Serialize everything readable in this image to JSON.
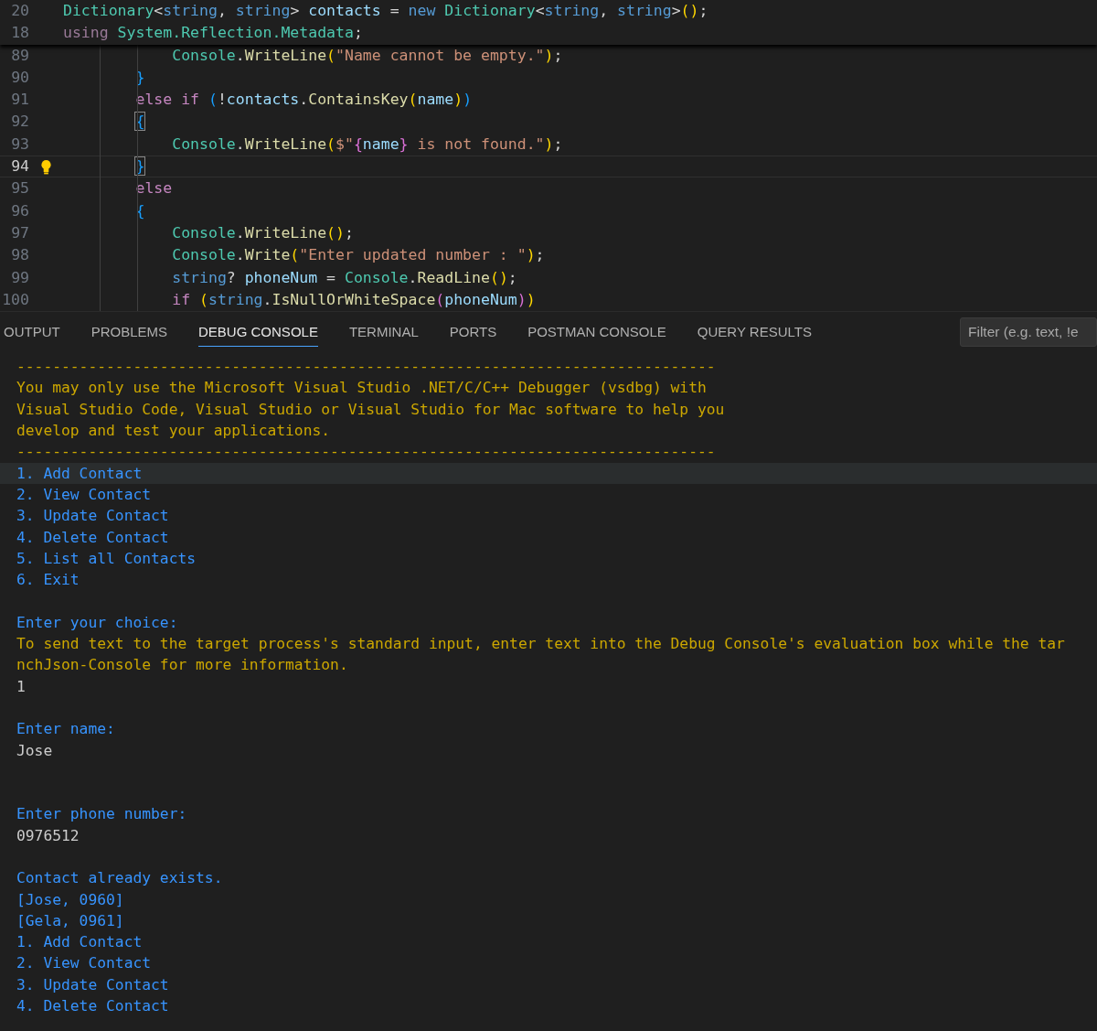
{
  "editor": {
    "sticky_lines": [
      {
        "number": "20",
        "tokens": [
          {
            "text": "Dictionary",
            "kind": "type"
          },
          {
            "text": "<",
            "kind": "plain"
          },
          {
            "text": "string",
            "kind": "key"
          },
          {
            "text": ", ",
            "kind": "plain"
          },
          {
            "text": "string",
            "kind": "key"
          },
          {
            "text": "> ",
            "kind": "plain"
          },
          {
            "text": "contacts",
            "kind": "var"
          },
          {
            "text": " = ",
            "kind": "plain"
          },
          {
            "text": "new ",
            "kind": "key"
          },
          {
            "text": "Dictionary",
            "kind": "type"
          },
          {
            "text": "<",
            "kind": "plain"
          },
          {
            "text": "string",
            "kind": "key"
          },
          {
            "text": ", ",
            "kind": "plain"
          },
          {
            "text": "string",
            "kind": "key"
          },
          {
            "text": ">",
            "kind": "plain"
          },
          {
            "text": "()",
            "kind": "b1"
          },
          {
            "text": ";",
            "kind": "plain"
          }
        ]
      },
      {
        "number": "18",
        "tokens": [
          {
            "text": "using ",
            "kind": "ctrl"
          },
          {
            "text": "System.Reflection.Metadata",
            "kind": "type"
          },
          {
            "text": ";",
            "kind": "plain"
          }
        ]
      }
    ],
    "lines": [
      {
        "number": "89",
        "current": false,
        "lightbulb": false,
        "tokens": [
          {
            "text": "            Console",
            "kind": "type"
          },
          {
            "text": ".",
            "kind": "plain"
          },
          {
            "text": "WriteLine",
            "kind": "fn"
          },
          {
            "text": "(",
            "kind": "b1"
          },
          {
            "text": "\"Name cannot be empty.\"",
            "kind": "str"
          },
          {
            "text": ")",
            "kind": "b1"
          },
          {
            "text": ";",
            "kind": "plain"
          }
        ]
      },
      {
        "number": "90",
        "current": false,
        "lightbulb": false,
        "tokens": [
          {
            "text": "        }",
            "kind": "b3"
          }
        ]
      },
      {
        "number": "91",
        "current": false,
        "lightbulb": false,
        "tokens": [
          {
            "text": "        else if ",
            "kind": "ctrl"
          },
          {
            "text": "(",
            "kind": "b3"
          },
          {
            "text": "!",
            "kind": "plain"
          },
          {
            "text": "contacts",
            "kind": "var"
          },
          {
            "text": ".",
            "kind": "plain"
          },
          {
            "text": "ContainsKey",
            "kind": "fn"
          },
          {
            "text": "(",
            "kind": "b1"
          },
          {
            "text": "name",
            "kind": "var"
          },
          {
            "text": ")",
            "kind": "b1"
          },
          {
            "text": ")",
            "kind": "b3"
          }
        ]
      },
      {
        "number": "92",
        "current": false,
        "lightbulb": false,
        "tokens": [
          {
            "text": "        {",
            "kind": "match"
          }
        ]
      },
      {
        "number": "93",
        "current": false,
        "lightbulb": false,
        "tokens": [
          {
            "text": "            Console",
            "kind": "type"
          },
          {
            "text": ".",
            "kind": "plain"
          },
          {
            "text": "WriteLine",
            "kind": "fn"
          },
          {
            "text": "(",
            "kind": "b1"
          },
          {
            "text": "$\"",
            "kind": "str"
          },
          {
            "text": "{",
            "kind": "b2"
          },
          {
            "text": "name",
            "kind": "var"
          },
          {
            "text": "}",
            "kind": "b2"
          },
          {
            "text": " is not found.\"",
            "kind": "str"
          },
          {
            "text": ")",
            "kind": "b1"
          },
          {
            "text": ";",
            "kind": "plain"
          }
        ]
      },
      {
        "number": "94",
        "current": true,
        "lightbulb": true,
        "tokens": [
          {
            "text": "        }",
            "kind": "match"
          }
        ]
      },
      {
        "number": "95",
        "current": false,
        "lightbulb": false,
        "tokens": [
          {
            "text": "        else",
            "kind": "ctrl"
          }
        ]
      },
      {
        "number": "96",
        "current": false,
        "lightbulb": false,
        "tokens": [
          {
            "text": "        {",
            "kind": "b3"
          }
        ]
      },
      {
        "number": "97",
        "current": false,
        "lightbulb": false,
        "tokens": [
          {
            "text": "            Console",
            "kind": "type"
          },
          {
            "text": ".",
            "kind": "plain"
          },
          {
            "text": "WriteLine",
            "kind": "fn"
          },
          {
            "text": "()",
            "kind": "b1"
          },
          {
            "text": ";",
            "kind": "plain"
          }
        ]
      },
      {
        "number": "98",
        "current": false,
        "lightbulb": false,
        "tokens": [
          {
            "text": "            Console",
            "kind": "type"
          },
          {
            "text": ".",
            "kind": "plain"
          },
          {
            "text": "Write",
            "kind": "fn"
          },
          {
            "text": "(",
            "kind": "b1"
          },
          {
            "text": "\"Enter updated number : \"",
            "kind": "str"
          },
          {
            "text": ")",
            "kind": "b1"
          },
          {
            "text": ";",
            "kind": "plain"
          }
        ]
      },
      {
        "number": "99",
        "current": false,
        "lightbulb": false,
        "tokens": [
          {
            "text": "            string",
            "kind": "key"
          },
          {
            "text": "? ",
            "kind": "plain"
          },
          {
            "text": "phoneNum",
            "kind": "var"
          },
          {
            "text": " = ",
            "kind": "plain"
          },
          {
            "text": "Console",
            "kind": "type"
          },
          {
            "text": ".",
            "kind": "plain"
          },
          {
            "text": "ReadLine",
            "kind": "fn"
          },
          {
            "text": "()",
            "kind": "b1"
          },
          {
            "text": ";",
            "kind": "plain"
          }
        ]
      },
      {
        "number": "100",
        "current": false,
        "lightbulb": false,
        "tokens": [
          {
            "text": "            if ",
            "kind": "ctrl"
          },
          {
            "text": "(",
            "kind": "b1"
          },
          {
            "text": "string",
            "kind": "key"
          },
          {
            "text": ".",
            "kind": "plain"
          },
          {
            "text": "IsNullOrWhiteSpace",
            "kind": "fn"
          },
          {
            "text": "(",
            "kind": "b2"
          },
          {
            "text": "phoneNum",
            "kind": "var"
          },
          {
            "text": ")",
            "kind": "b2"
          },
          {
            "text": ")",
            "kind": "b1"
          }
        ]
      }
    ]
  },
  "panel": {
    "tabs": [
      {
        "label": "OUTPUT",
        "selected": false
      },
      {
        "label": "PROBLEMS",
        "selected": false
      },
      {
        "label": "DEBUG CONSOLE",
        "selected": true
      },
      {
        "label": "TERMINAL",
        "selected": false
      },
      {
        "label": "PORTS",
        "selected": false
      },
      {
        "label": "POSTMAN CONSOLE",
        "selected": false
      },
      {
        "label": "QUERY RESULTS",
        "selected": false
      }
    ],
    "filter": {
      "placeholder": "Filter (e.g. text, !e"
    },
    "console": [
      {
        "kind": "warn",
        "text": "------------------------------------------------------------------------------",
        "selected": false
      },
      {
        "kind": "warn",
        "text": "You may only use the Microsoft Visual Studio .NET/C/C++ Debugger (vsdbg) with\nVisual Studio Code, Visual Studio or Visual Studio for Mac software to help you\ndevelop and test your applications.",
        "selected": false
      },
      {
        "kind": "warn",
        "text": "------------------------------------------------------------------------------",
        "selected": false
      },
      {
        "kind": "info",
        "text": "1. Add Contact",
        "selected": true
      },
      {
        "kind": "info",
        "text": "2. View Contact",
        "selected": false
      },
      {
        "kind": "info",
        "text": "3. Update Contact",
        "selected": false
      },
      {
        "kind": "info",
        "text": "4. Delete Contact",
        "selected": false
      },
      {
        "kind": "info",
        "text": "5. List all Contacts",
        "selected": false
      },
      {
        "kind": "info",
        "text": "6. Exit",
        "selected": false
      },
      {
        "kind": "blank",
        "selected": false
      },
      {
        "kind": "info",
        "text": "Enter your choice:",
        "selected": false
      },
      {
        "kind": "warn",
        "text": "To send text to the target process's standard input, enter text into the Debug Console's evaluation box while the tar\nnchJson-Console for more information.",
        "selected": false
      },
      {
        "kind": "input",
        "text": "1",
        "selected": false
      },
      {
        "kind": "blank",
        "selected": false
      },
      {
        "kind": "info",
        "text": "Enter name:",
        "selected": false
      },
      {
        "kind": "input",
        "text": "Jose",
        "selected": false
      },
      {
        "kind": "blank",
        "selected": false
      },
      {
        "kind": "blank",
        "selected": false
      },
      {
        "kind": "info",
        "text": "Enter phone number:",
        "selected": false
      },
      {
        "kind": "input",
        "text": "0976512",
        "selected": false
      },
      {
        "kind": "blank",
        "selected": false
      },
      {
        "kind": "info",
        "text": "Contact already exists.",
        "selected": false
      },
      {
        "kind": "info",
        "text": "[Jose, 0960]",
        "selected": false
      },
      {
        "kind": "info",
        "text": "[Gela, 0961]",
        "selected": false
      },
      {
        "kind": "info",
        "text": "1. Add Contact",
        "selected": false
      },
      {
        "kind": "info",
        "text": "2. View Contact",
        "selected": false
      },
      {
        "kind": "info",
        "text": "3. Update Contact",
        "selected": false
      },
      {
        "kind": "info",
        "text": "4. Delete Contact",
        "selected": false
      }
    ]
  }
}
